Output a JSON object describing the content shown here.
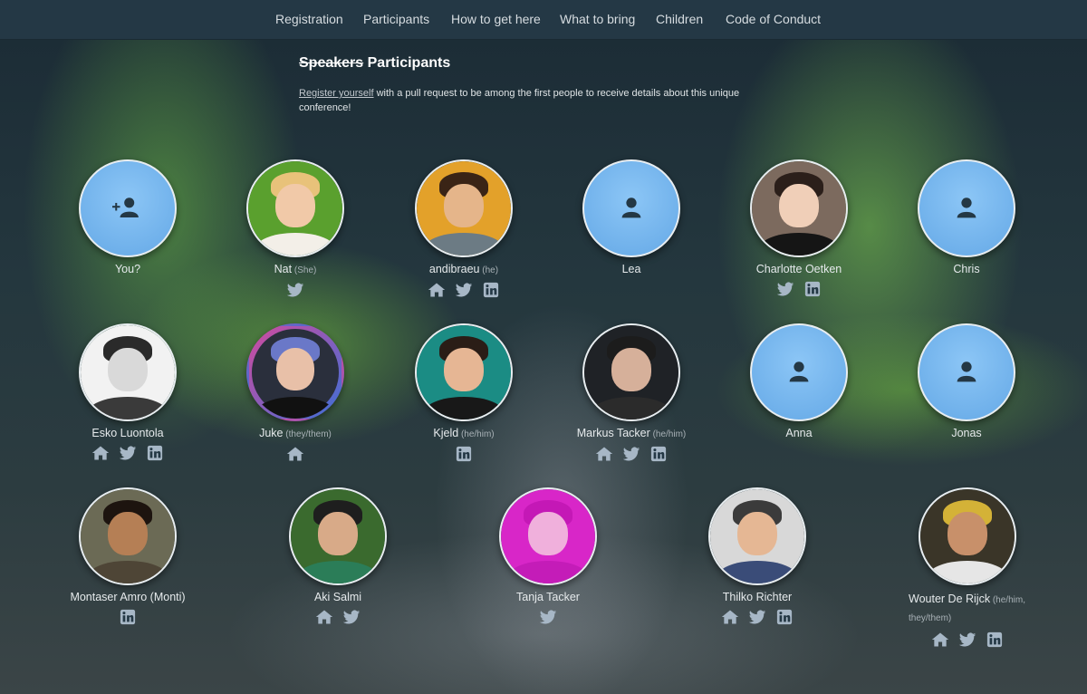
{
  "nav": {
    "items": [
      "Registration",
      "Participants",
      "How to get here",
      "What to bring",
      "Children",
      "Code of Conduct"
    ]
  },
  "heading": {
    "struck": "Speakers",
    "main": "Participants"
  },
  "intro": {
    "link": "Register yourself",
    "text": " with a pull request to be among the first people to receive details about this unique conference!"
  },
  "participants": [
    {
      "name": "You?",
      "pronouns": "",
      "avatar": "add-user",
      "links": []
    },
    {
      "name": "Nat",
      "pronouns": "(She)",
      "avatar": "photo",
      "links": [
        "twitter"
      ]
    },
    {
      "name": "andibraeu",
      "pronouns": "(he)",
      "avatar": "photo",
      "links": [
        "home",
        "twitter",
        "linkedin"
      ]
    },
    {
      "name": "Lea",
      "pronouns": "",
      "avatar": "user",
      "links": []
    },
    {
      "name": "Charlotte Oetken",
      "pronouns": "",
      "avatar": "photo",
      "links": [
        "twitter",
        "linkedin"
      ]
    },
    {
      "name": "Chris",
      "pronouns": "",
      "avatar": "user",
      "links": []
    },
    {
      "name": "Esko Luontola",
      "pronouns": "",
      "avatar": "photo",
      "links": [
        "home",
        "twitter",
        "linkedin"
      ]
    },
    {
      "name": "Juke",
      "pronouns": "(they/them)",
      "avatar": "photo",
      "links": [
        "home"
      ]
    },
    {
      "name": "Kjeld",
      "pronouns": "(he/him)",
      "avatar": "photo",
      "links": [
        "linkedin"
      ]
    },
    {
      "name": "Markus Tacker",
      "pronouns": "(he/him)",
      "avatar": "photo",
      "links": [
        "home",
        "twitter",
        "linkedin"
      ]
    },
    {
      "name": "Anna",
      "pronouns": "",
      "avatar": "user",
      "links": []
    },
    {
      "name": "Jonas",
      "pronouns": "",
      "avatar": "user",
      "links": []
    },
    {
      "name": "Montaser Amro (Monti)",
      "pronouns": "",
      "avatar": "photo",
      "links": [
        "linkedin"
      ]
    },
    {
      "name": "Aki Salmi",
      "pronouns": "",
      "avatar": "photo",
      "links": [
        "home",
        "twitter"
      ]
    },
    {
      "name": "Tanja Tacker",
      "pronouns": "",
      "avatar": "photo",
      "links": [
        "twitter"
      ]
    },
    {
      "name": "Thilko Richter",
      "pronouns": "",
      "avatar": "photo",
      "links": [
        "home",
        "twitter",
        "linkedin"
      ]
    },
    {
      "name": "Wouter De Rijck",
      "pronouns": "(he/him, they/them)",
      "avatar": "photo",
      "links": [
        "home",
        "twitter",
        "linkedin"
      ]
    }
  ],
  "colors": {
    "nav_bg": "#243845",
    "placeholder_blue": "#7ab8ef",
    "icon_color": "#a7b7c6",
    "text": "#e6eaec"
  }
}
